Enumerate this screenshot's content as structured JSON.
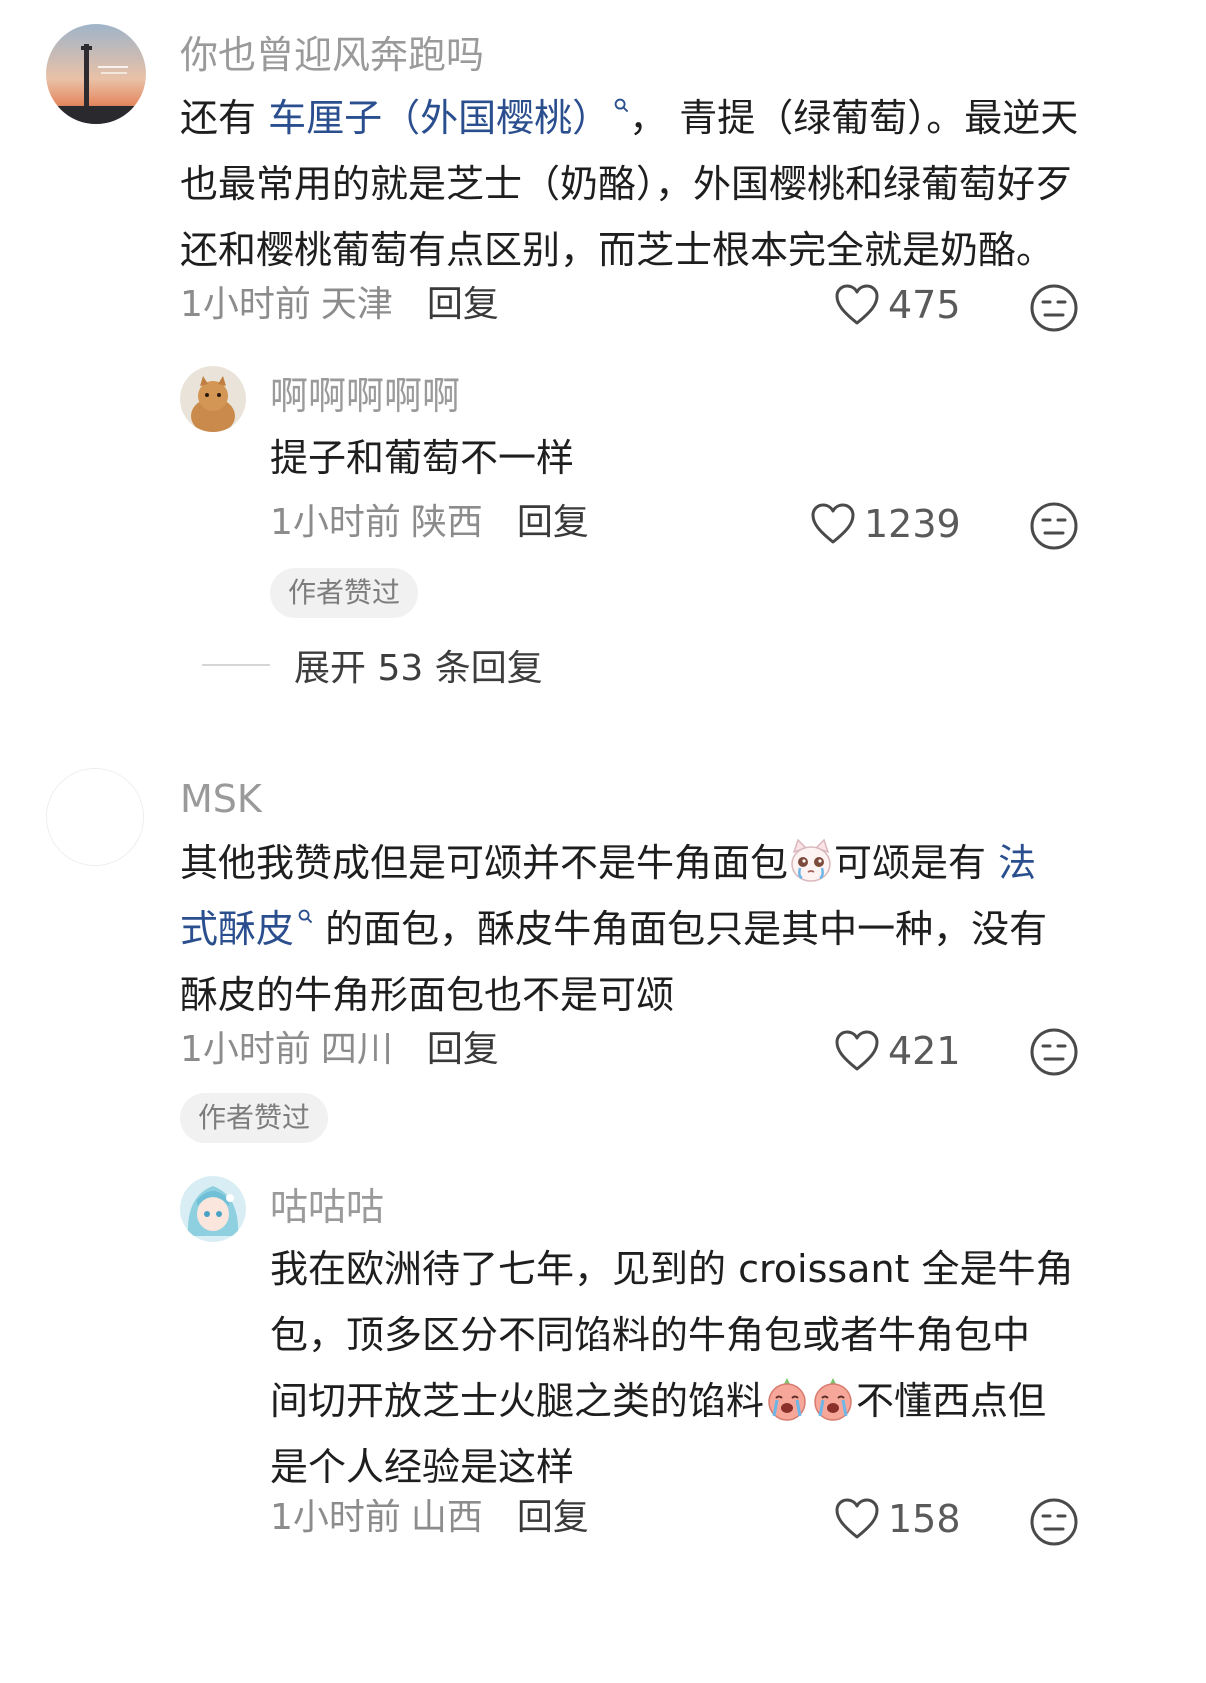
{
  "comments": [
    {
      "username": "你也曾迎风奔跑吗",
      "avatar_icon": "sunset-tower-avatar",
      "text_before": "还有 ",
      "link1": "车厘子（外国樱桃）",
      "text_middle": "， 青提（绿葡萄）。最逆天",
      "line2": "也最常用的就是芝士（奶酪），外国樱桃和绿葡萄好歹",
      "line3": "还和樱桃葡萄有点区别，而芝士根本完全就是奶酪。",
      "time": "1小时前",
      "location": "天津",
      "reply_label": "回复",
      "likes": "475",
      "replies": [
        {
          "username": "啊啊啊啊啊",
          "avatar_icon": "cat-avatar",
          "text": "提子和葡萄不一样",
          "time": "1小时前",
          "location": "陕西",
          "reply_label": "回复",
          "likes": "1239",
          "badge": "作者赞过"
        }
      ],
      "expand_label": "展开 53 条回复"
    },
    {
      "username": "MSK",
      "avatar_icon": "blank-avatar",
      "line1_before": "其他我赞成但是可颂并不是牛角面包",
      "line1_after": "可颂是有 ",
      "link1_part1": "法",
      "link1_part2": "式酥皮",
      "line2_after": " 的面包，酥皮牛角面包只是其中一种，没有",
      "line3": "酥皮的牛角形面包也不是可颂",
      "emoji_icon": "crying-cat-emoji",
      "time": "1小时前",
      "location": "四川",
      "reply_label": "回复",
      "likes": "421",
      "badge": "作者赞过",
      "replies": [
        {
          "username": "咕咕咕",
          "avatar_icon": "anime-girl-avatar",
          "line1": "我在欧洲待了七年，见到的 croissant 全是牛角",
          "line2": "包，顶多区分不同馅料的牛角包或者牛角包中",
          "line3_before": "间切开放芝士火腿之类的馅料",
          "line3_after": "不懂西点但",
          "line4": "是个人经验是这样",
          "emoji_icon": "crying-face-emoji",
          "time": "1小时前",
          "location": "山西",
          "reply_label": "回复",
          "likes": "158"
        }
      ]
    }
  ],
  "colors": {
    "link": "#2b4f8e",
    "meta": "#8c8c8c",
    "badge_bg": "#f1f1f1"
  },
  "icons": {
    "like": "heart-outline-icon",
    "dislike": "meh-face-icon",
    "search_mark": "search-icon"
  }
}
